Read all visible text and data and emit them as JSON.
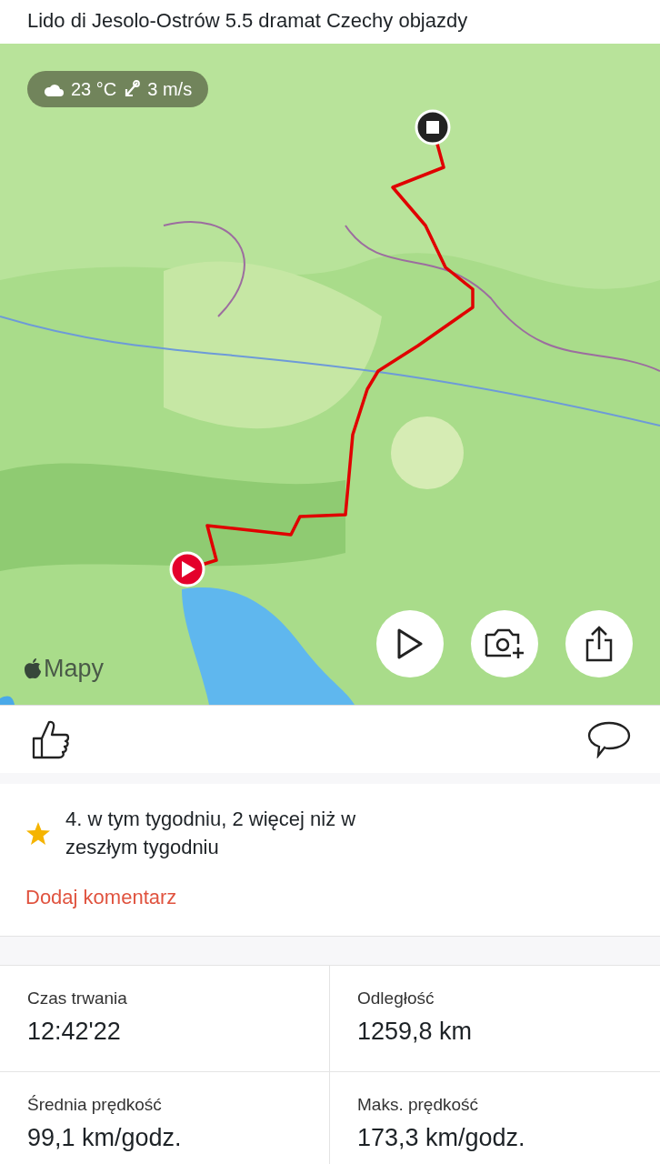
{
  "title": "Lido di Jesolo-Ostrów 5.5 dramat Czechy objazdy",
  "map": {
    "kind": "picture",
    "weather": {
      "temperature": "23 °C",
      "wind": "3 m/s"
    },
    "attribution": "Mapy"
  },
  "achievement": {
    "text": "4. w tym tygodniu, 2 więcej niż w zeszłym tygodniu",
    "color": "#f5b400"
  },
  "add_comment": "Dodaj komentarz",
  "stats": [
    {
      "label": "Czas trwania",
      "value": "12:42'22"
    },
    {
      "label": "Odległość",
      "value": "1259,8 km"
    },
    {
      "label": "Średnia prędkość",
      "value": "99,1 km/godz."
    },
    {
      "label": "Maks. prędkość",
      "value": "173,3 km/godz."
    }
  ]
}
